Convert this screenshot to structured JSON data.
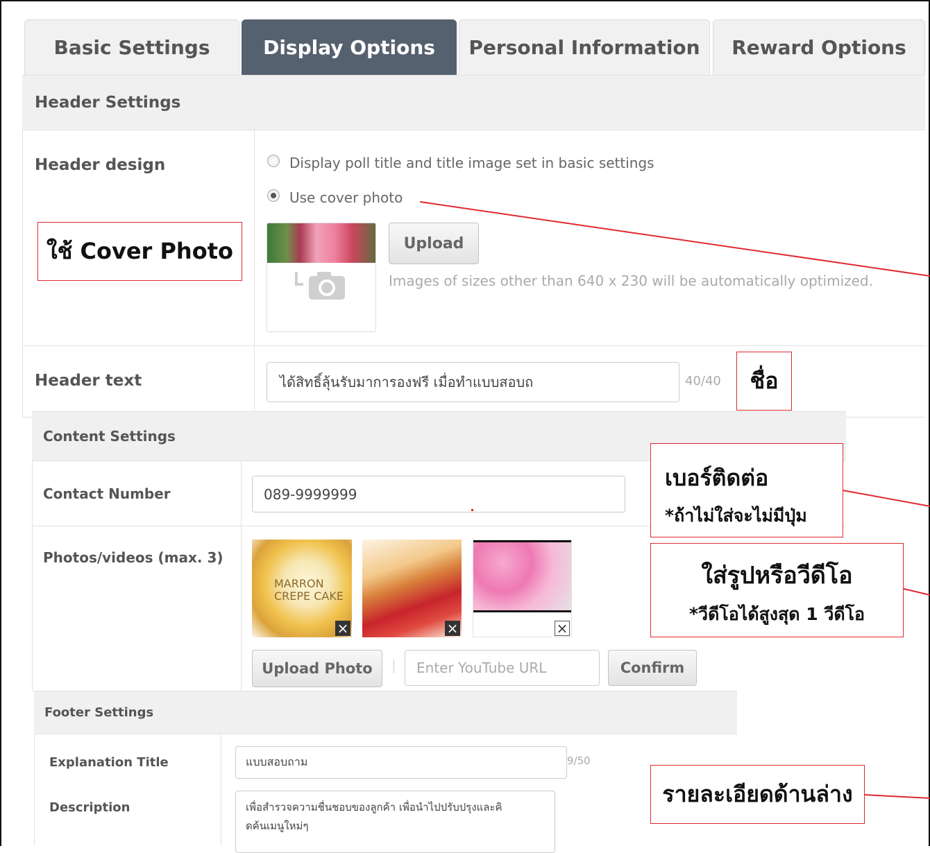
{
  "tabs": [
    {
      "label": "Basic Settings"
    },
    {
      "label": "Display Options"
    },
    {
      "label": "Personal Information"
    },
    {
      "label": "Reward Options"
    }
  ],
  "header_settings": {
    "title": "Header Settings",
    "design_label": "Header design",
    "option_1": "Display poll title and title image set in basic settings",
    "option_2": "Use cover photo",
    "upload_label": "Upload",
    "upload_hint": "Images of sizes other than 640 x 230 will be automatically optimized.",
    "text_label": "Header text",
    "text_value": "ได้สิทธิ์ลุ้นรับมาการองฟรี เมื่อทำแบบสอบถ",
    "text_counter": "40/40"
  },
  "content_settings": {
    "title": "Content Settings",
    "contact_label": "Contact Number",
    "contact_value": "089-9999999",
    "photos_label": "Photos/videos (max. 3)",
    "thumb_1_caption_1": "MARRON",
    "thumb_1_caption_2": "CREPE CAKE",
    "upload_photo_label": "Upload Photo",
    "youtube_placeholder": "Enter YouTube URL",
    "confirm_label": "Confirm"
  },
  "footer_settings": {
    "title": "Footer Settings",
    "explanation_label": "Explanation Title",
    "explanation_value": "แบบสอบถาม",
    "explanation_counter": "9/50",
    "description_label": "Description",
    "description_line_1": "เพื่อสำรวจความชื่นชอบของลูกค้า เพื่อนำไปปรับปรุงและคิ",
    "description_line_2": "ดค้นเมนูใหม่ๆ"
  },
  "annotations": {
    "cover_photo": "ใช้ Cover Photo",
    "name": "ชื่อ",
    "contact_title": "เบอร์ติดต่อ",
    "contact_note": "*ถ้าไม่ใส่จะไม่มีปุ่ม",
    "media_title": "ใส่รูปหรือวีดีโอ",
    "media_note": "*วีดีโอได้สูงสุด 1 วีดีโอ",
    "footer_detail": "รายละเอียดด้านล่าง"
  },
  "colors": {
    "active_tab": "#56616f",
    "annotation_red": "#e0282e"
  }
}
